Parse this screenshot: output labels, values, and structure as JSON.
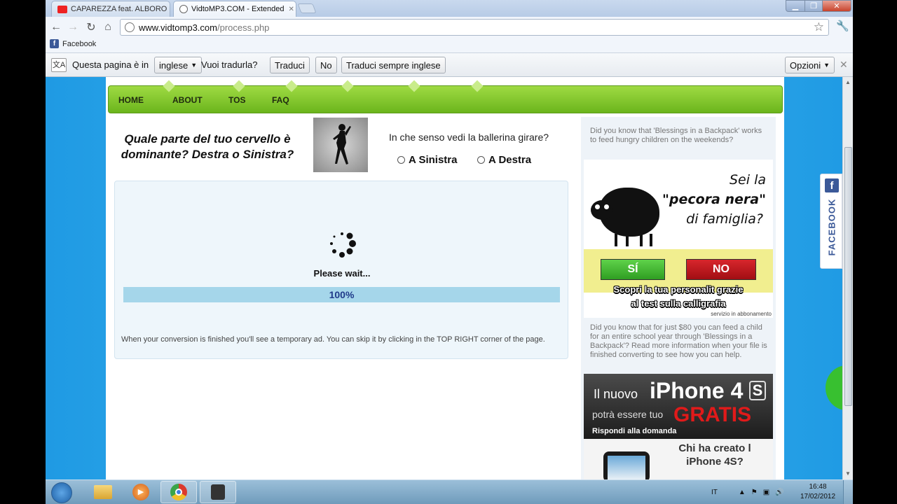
{
  "browser": {
    "tabs": [
      {
        "label": "CAPAREZZA feat. ALBORO"
      },
      {
        "label": "VidtoMP3.COM - Extended"
      }
    ],
    "url_host": "www.vidtomp3.com",
    "url_path": "/process.php",
    "bookmarks": [
      {
        "label": "Facebook"
      }
    ]
  },
  "translate_bar": {
    "prefix": "Questa pagina è in",
    "language": "inglese",
    "question": "Vuoi tradurla?",
    "translate_label": "Traduci",
    "no_label": "No",
    "always_label": "Traduci sempre inglese",
    "options_label": "Opzioni"
  },
  "site": {
    "nav": [
      {
        "label": "HOME"
      },
      {
        "label": "ABOUT"
      },
      {
        "label": "TOS"
      },
      {
        "label": "FAQ"
      }
    ],
    "quiz": {
      "title": "Quale parte del tuo cervello è dominante? Destra o Sinistra?",
      "question": "In che senso vedi la ballerina girare?",
      "option_left": "A Sinistra",
      "option_right": "A Destra"
    },
    "process": {
      "status": "Please wait...",
      "progress_percent": 100,
      "progress_label": "100%",
      "note": "When your conversion is finished you'll see a temporary ad. You can skip it by clicking in the TOP RIGHT corner of the page."
    },
    "sidebar": {
      "text1": "Did you know that 'Blessings in a Backpack' works to feed hungry children on the weekends?",
      "sheep_ad": {
        "line1": "Sei la",
        "line2": "\"pecora nera\"",
        "line3": "di famiglia?",
        "yes": "SÍ",
        "no": "NO",
        "caption1": "Scopri la tua personalit grazie",
        "caption2": "al test sulla calligrafia",
        "small": "servizio in abbonamento"
      },
      "text2": "Did you know that for just $80 you can feed a child for an entire school year through 'Blessings in a Backpack'? Read more information when your file is finished converting to see how you can help.",
      "iphone_ad": {
        "line1a": "Il nuovo",
        "line1b": "iPhone 4",
        "s_badge": "S",
        "line2a": "potrà essere tuo",
        "line2b": "GRATIS",
        "line3": "Rispondi alla domanda",
        "question1": "Chi ha creato l",
        "question2": "iPhone 4S?"
      }
    },
    "facebook_tab": "FACEBOOK"
  },
  "taskbar": {
    "language": "IT",
    "time": "16:48",
    "date": "17/02/2012"
  },
  "colors": {
    "nav_green": "#7cc425",
    "page_blue": "#38b0ee",
    "progress_fill": "#a5d6ea",
    "yes_green": "#3fb52a",
    "no_red": "#c3141b",
    "facebook_blue": "#3b5998"
  }
}
